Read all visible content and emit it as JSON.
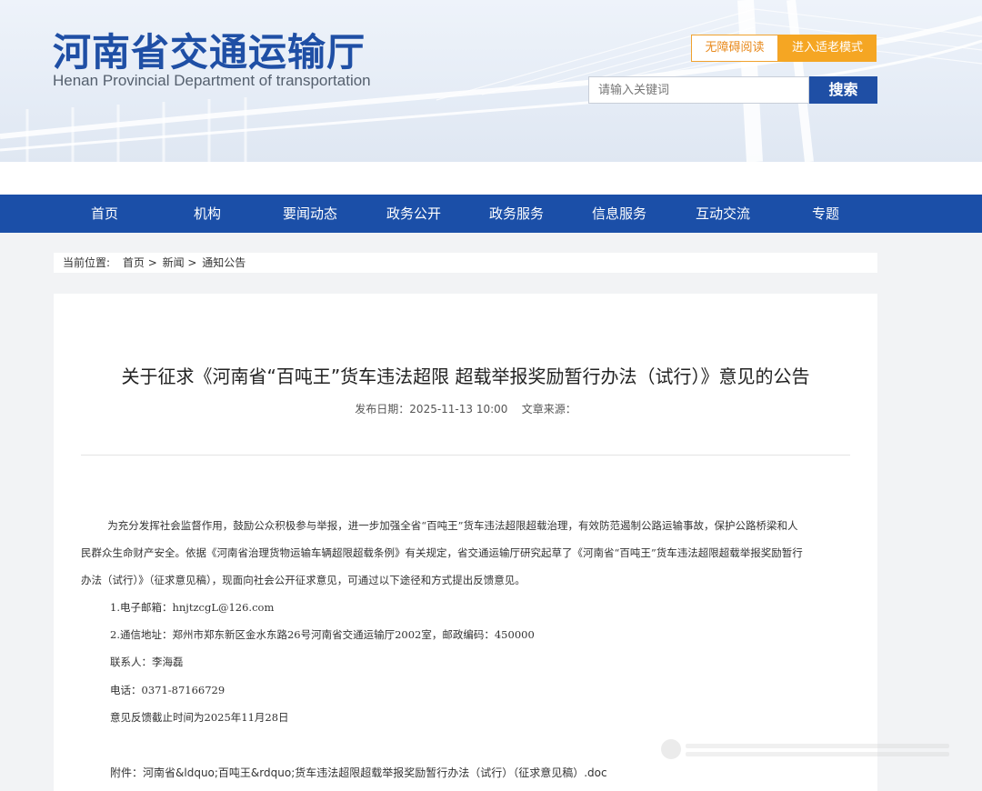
{
  "header": {
    "logo_cn": "河南省交通运输厅",
    "logo_en": "Henan Provincial Department of transportation",
    "accessibility_btn": "无障碍阅读",
    "elder_mode_btn": "进入适老模式",
    "search_placeholder": "请输入关键词",
    "search_btn": "搜索"
  },
  "nav": {
    "items": [
      "首页",
      "机构",
      "要闻动态",
      "政务公开",
      "政务服务",
      "信息服务",
      "互动交流",
      "专题"
    ]
  },
  "breadcrumb": {
    "prefix": "当前位置:",
    "items": [
      "首页",
      "新闻",
      "通知公告"
    ],
    "sep": " > "
  },
  "article": {
    "title": "关于征求《河南省“百吨王”货车违法超限 超载举报奖励暂行办法（试行）》意见的公告",
    "meta": "发布日期：2025-11-13 10:00    文章来源：",
    "para1_l1": "        为充分发挥社会监督作用，鼓励公众积极参与举报，进一步加强全省“百吨王”货车违法超限超载治理，有效防范遏制公路运输事故，保护公路桥梁和人",
    "para1_l2": "民群众生命财产安全。依据《河南省治理货物运输车辆超限超载条例》有关规定，省交通运输厅研究起草了《河南省“百吨王”货车违法超限超载举报奖励暂行",
    "para1_l3": "办法（试行）》（征求意见稿），现面向社会公开征求意见，可通过以下途径和方式提出反馈意见。",
    "line_email": "1.电子邮箱：hnjtzcgL@126.com",
    "line_address": "2.通信地址：郑州市郑东新区金水东路26号河南省交通运输厅2002室，邮政编码：450000",
    "line_contact": "联系人：李海磊",
    "line_phone": "电话：0371-87166729",
    "line_deadline": "意见反馈截止时间为2025年11月28日",
    "attachment_prefix": "附件：",
    "attachment_link": "河南省&ldquo;百吨王&rdquo;货车违法超限超载举报奖励暂行办法（试行）（征求意见稿）.doc"
  },
  "colors": {
    "brand_blue": "#1b4fa8",
    "accent_orange": "#f5a623"
  }
}
